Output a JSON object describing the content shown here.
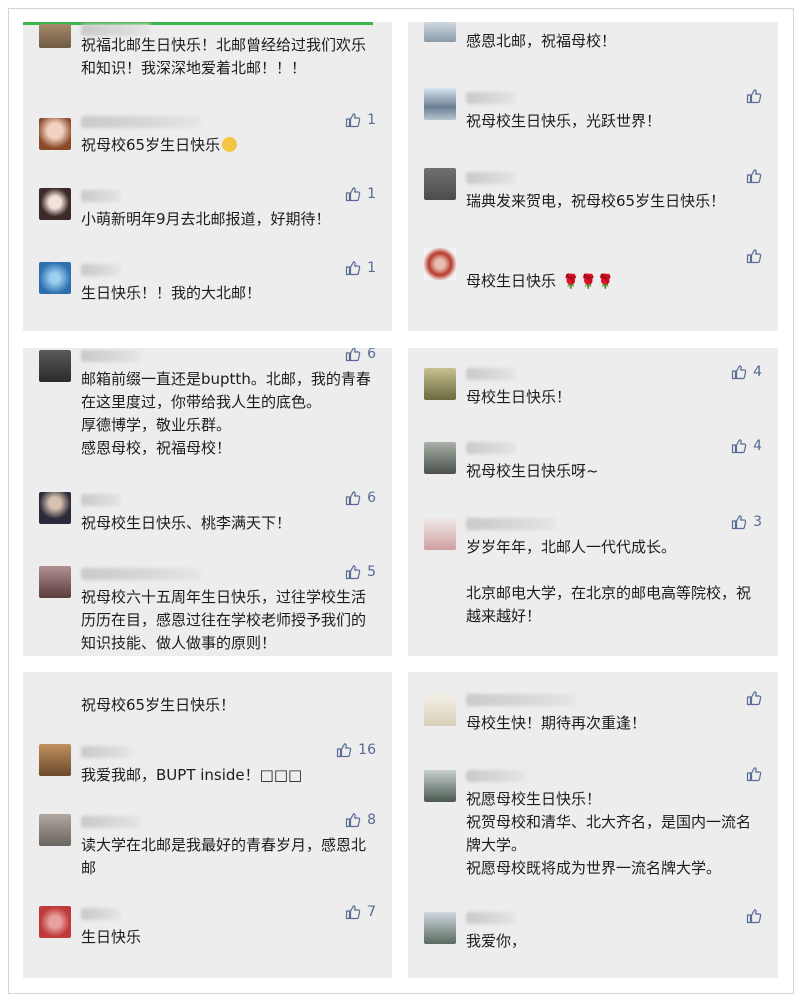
{
  "panel1": {
    "c1": {
      "text": "祝福北邮生日快乐！北邮曾经给过我们欢乐和知识！我深深地爱着北邮！！！"
    },
    "c2": {
      "text": "祝母校65岁生日快乐",
      "likes": "1"
    },
    "c3": {
      "text": "小萌新明年9月去北邮报道，好期待！",
      "likes": "1"
    },
    "c4": {
      "text": "生日快乐！！我的大北邮！",
      "likes": "1"
    }
  },
  "panel2": {
    "c1": {
      "text": "感恩北邮，祝福母校！"
    },
    "c2": {
      "text": "祝母校生日快乐，光跃世界！"
    },
    "c3": {
      "text": "瑞典发来贺电，祝母校65岁生日快乐！"
    },
    "c4": {
      "text": "母校生日快乐"
    }
  },
  "panel3": {
    "c1": {
      "text": "邮箱前缀一直还是buptth。北邮，我的青春在这里度过，你带给我人生的底色。\n厚德博学，敬业乐群。\n感恩母校，祝福母校！",
      "likes": "6"
    },
    "c2": {
      "text": "祝母校生日快乐、桃李满天下！",
      "likes": "6"
    },
    "c3": {
      "text": "祝母校六十五周年生日快乐，过往学校生活历历在目，感恩过往在学校老师授予我们的知识技能、做人做事的原则！",
      "likes": "5"
    }
  },
  "panel4": {
    "c1": {
      "text": "母校生日快乐！",
      "likes": "4"
    },
    "c2": {
      "text": "祝母校生日快乐呀~",
      "likes": "4"
    },
    "c3": {
      "text": "岁岁年年，北邮人一代代成长。\n\n北京邮电大学，在北京的邮电高等院校，祝越来越好！",
      "likes": "3"
    }
  },
  "panel5": {
    "c1": {
      "text": "祝母校65岁生日快乐！"
    },
    "c2": {
      "text": "我爱我邮，BUPT inside！□□□",
      "likes": "16"
    },
    "c3": {
      "text": "读大学在北邮是我最好的青春岁月，感恩北邮",
      "likes": "8"
    },
    "c4": {
      "text": "生日快乐",
      "likes": "7"
    }
  },
  "panel6": {
    "c1": {
      "text": "母校生快！期待再次重逢！"
    },
    "c2": {
      "text": "祝愿母校生日快乐！\n祝贺母校和清华、北大齐名，是国内一流名牌大学。\n祝愿母校既将成为世界一流名牌大学。"
    },
    "c3": {
      "text": "我爱你，"
    }
  },
  "colors": {
    "panel_bg": "#ededed",
    "link_blue": "#576b95",
    "accent_green": "#3bb64a"
  }
}
